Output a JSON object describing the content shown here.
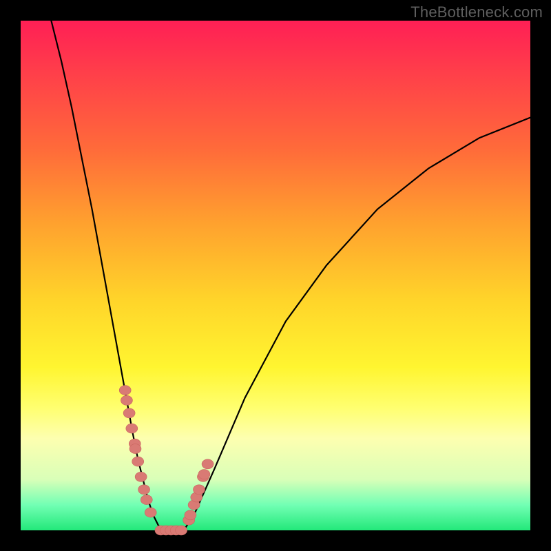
{
  "watermark": "TheBottleneck.com",
  "chart_data": {
    "type": "line",
    "title": "",
    "xlabel": "",
    "ylabel": "",
    "xlim": [
      0,
      100
    ],
    "ylim": [
      0,
      100
    ],
    "background_gradient": {
      "top_color": "#ff1f55",
      "bottom_color": "#23e87a",
      "meaning": "top red = high bottleneck, bottom green = no bottleneck"
    },
    "series": [
      {
        "name": "bottleneck-curve",
        "stroke": "#000000",
        "x": [
          6,
          8,
          10,
          12,
          14,
          16,
          18,
          20,
          22,
          23,
          24,
          25,
          26,
          27,
          28,
          29,
          30,
          31,
          32,
          34,
          38,
          44,
          52,
          60,
          70,
          80,
          90,
          100
        ],
        "y": [
          100,
          92,
          83,
          73,
          63,
          52,
          41,
          30,
          19,
          14,
          10,
          6,
          3,
          1,
          0,
          0,
          0,
          0,
          0,
          3,
          12,
          26,
          41,
          52,
          63,
          71,
          77,
          81
        ]
      }
    ],
    "markers": {
      "name": "scatter-points",
      "fill": "#d97a74",
      "x": [
        20.5,
        20.8,
        21.3,
        21.8,
        22.4,
        22.5,
        23.0,
        23.6,
        24.2,
        24.7,
        25.5,
        27.5,
        28.5,
        29.5,
        30.5,
        31.5,
        33.0,
        33.3,
        34.0,
        34.5,
        35.0,
        35.8,
        36.0,
        36.7
      ],
      "y": [
        27.5,
        25.5,
        23.0,
        20.0,
        17.0,
        16.0,
        13.5,
        10.5,
        8.0,
        6.0,
        3.5,
        0.0,
        0.0,
        0.0,
        0.0,
        0.0,
        2.0,
        3.0,
        5.0,
        6.5,
        8.0,
        10.5,
        11.0,
        13.0
      ]
    }
  }
}
